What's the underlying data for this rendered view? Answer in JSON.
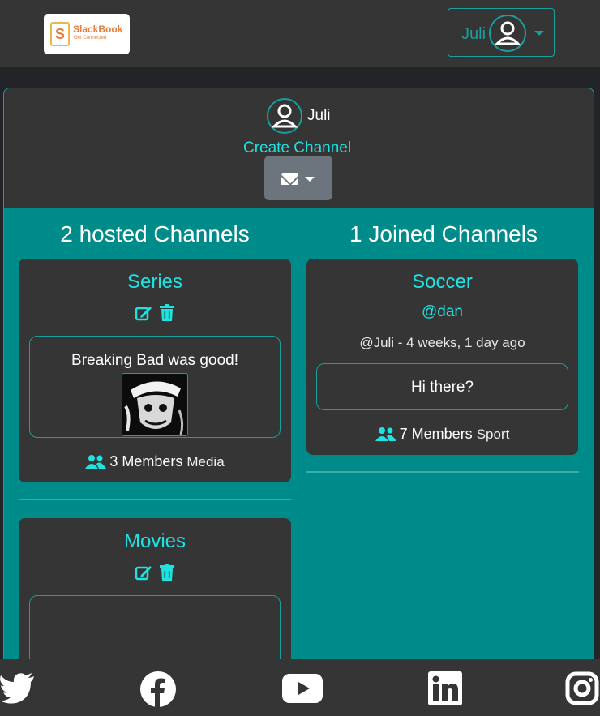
{
  "header": {
    "logo": {
      "letter": "S",
      "brand": "SlackBook",
      "tagline": "Get Connected"
    },
    "user_menu": {
      "name": "Juli",
      "avatar_icon": "user-circle-icon",
      "caret_icon": "chevron-down-icon"
    }
  },
  "profile": {
    "name": "Juli",
    "create_channel_label": "Create Channel",
    "message_dropdown_icon": "envelope-icon"
  },
  "hosted": {
    "heading": "2 hosted Channels",
    "channels": [
      {
        "title": "Series",
        "message": "Breaking Bad was good!",
        "members": "3 Members",
        "category": "Media"
      },
      {
        "title": "Movies"
      }
    ]
  },
  "joined": {
    "heading": "1 Joined Channels",
    "channels": [
      {
        "title": "Soccer",
        "host": "@dan",
        "meta": "@Juli - 4 weeks, 1 day ago",
        "message": "Hi there?",
        "members": "7 Members",
        "category": "Sport"
      }
    ]
  },
  "footer": {
    "icons": [
      "twitter-icon",
      "facebook-icon",
      "youtube-icon",
      "linkedin-icon",
      "instagram-icon"
    ]
  },
  "colors": {
    "accent": "#1ee3e3",
    "teal": "#008b8b",
    "panel": "#353535",
    "border": "#1a9e9e"
  }
}
